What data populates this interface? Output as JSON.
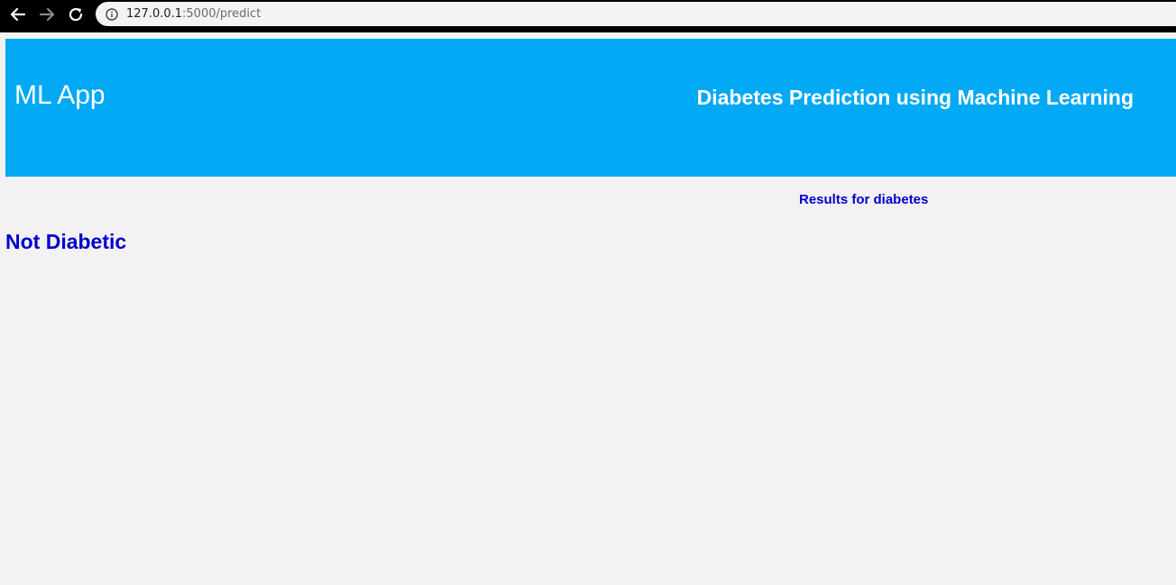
{
  "browser": {
    "url_host": "127.0.0.1",
    "url_path": ":5000/predict",
    "icons": {
      "back": "back-arrow-icon",
      "forward": "forward-arrow-icon",
      "reload": "reload-icon",
      "info": "info-icon"
    }
  },
  "header": {
    "app_name": "ML App",
    "title": "Diabetes Prediction using Machine Learning"
  },
  "main": {
    "results_heading": "Results for diabetes",
    "prediction": "Not Diabetic"
  },
  "colors": {
    "header_background": "#03a9f4",
    "page_background": "#f3f1f2",
    "result_text": "#0000cd"
  }
}
